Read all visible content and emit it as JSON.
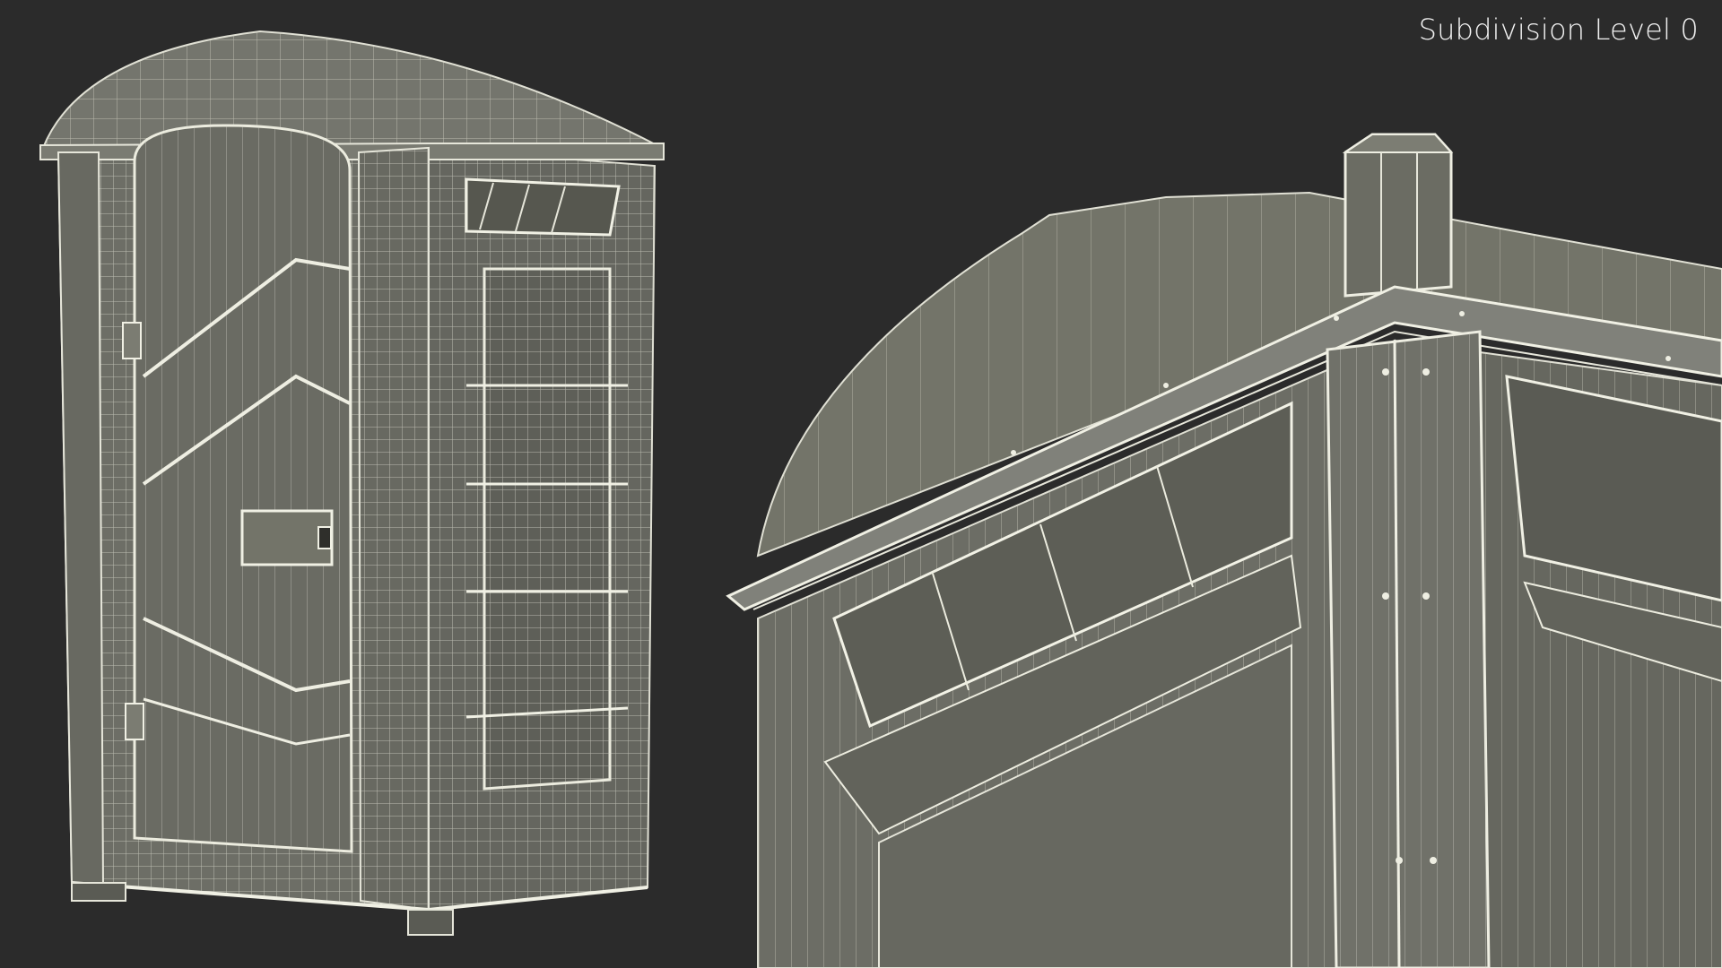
{
  "viewport": {
    "subdivision_label": "Subdivision Level 0",
    "background_color": "#2b2b2b",
    "mesh_fill_color": "#6f7068",
    "wire_color": "#dcdcd0"
  },
  "views": [
    {
      "name": "full-object-view",
      "subject": "portable-toilet-wireframe"
    },
    {
      "name": "closeup-roof-vent-view",
      "subject": "portable-toilet-roof-corner-wireframe"
    }
  ]
}
